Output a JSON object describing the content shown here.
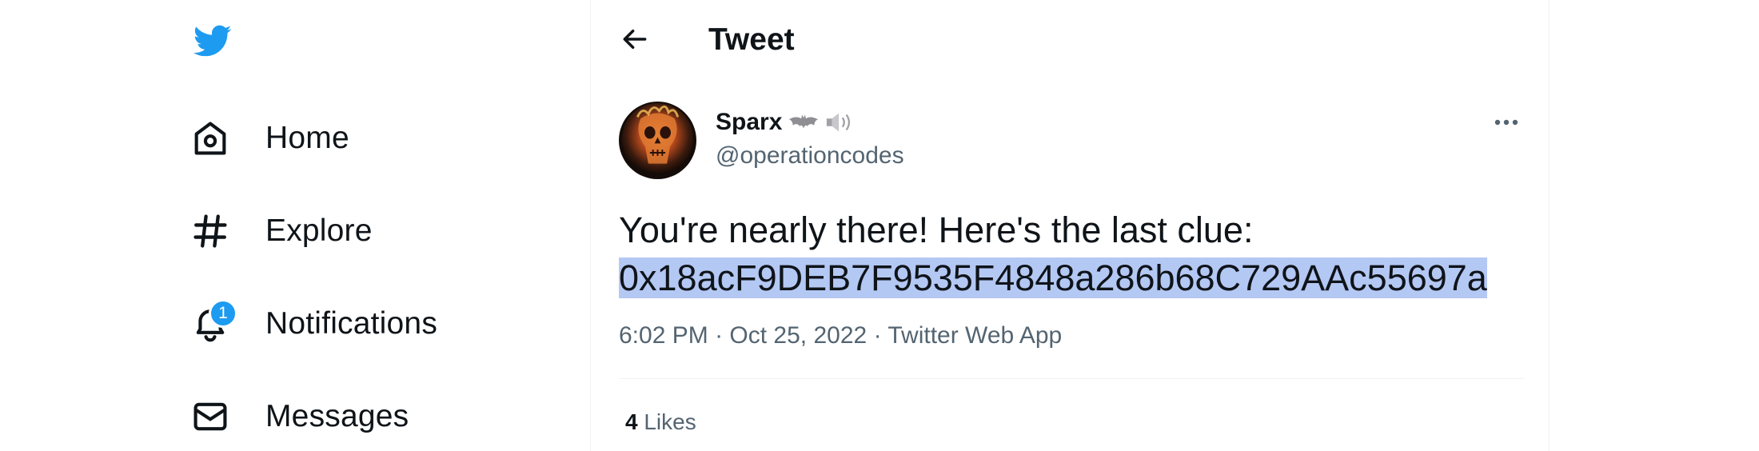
{
  "sidebar": {
    "logo_icon": "twitter-bird-icon",
    "brand_color": "#1d9bf0",
    "items": [
      {
        "label": "Home",
        "icon": "home-icon"
      },
      {
        "label": "Explore",
        "icon": "hashtag-icon"
      },
      {
        "label": "Notifications",
        "icon": "bell-icon",
        "badge": "1"
      },
      {
        "label": "Messages",
        "icon": "envelope-icon"
      }
    ]
  },
  "header": {
    "back_icon": "back-arrow-icon",
    "title": "Tweet"
  },
  "tweet": {
    "author": {
      "display_name": "Sparx",
      "name_emojis": [
        "bat-emoji",
        "speaker-emoji"
      ],
      "handle": "@operationcodes"
    },
    "more_icon": "more-horizontal-icon",
    "text_line1": "You're nearly there! Here's the last clue:",
    "text_line2_selected": "0x18acF9DEB7F9535F4848a286b68C729AAc55697a",
    "time": "6:02 PM",
    "date": "Oct 25, 2022",
    "source": "Twitter Web App",
    "separator": "·",
    "likes_count": "4",
    "likes_label": "Likes"
  },
  "colors": {
    "text_primary": "#0f1419",
    "text_secondary": "#536471",
    "selection": "#b4c8f4"
  }
}
